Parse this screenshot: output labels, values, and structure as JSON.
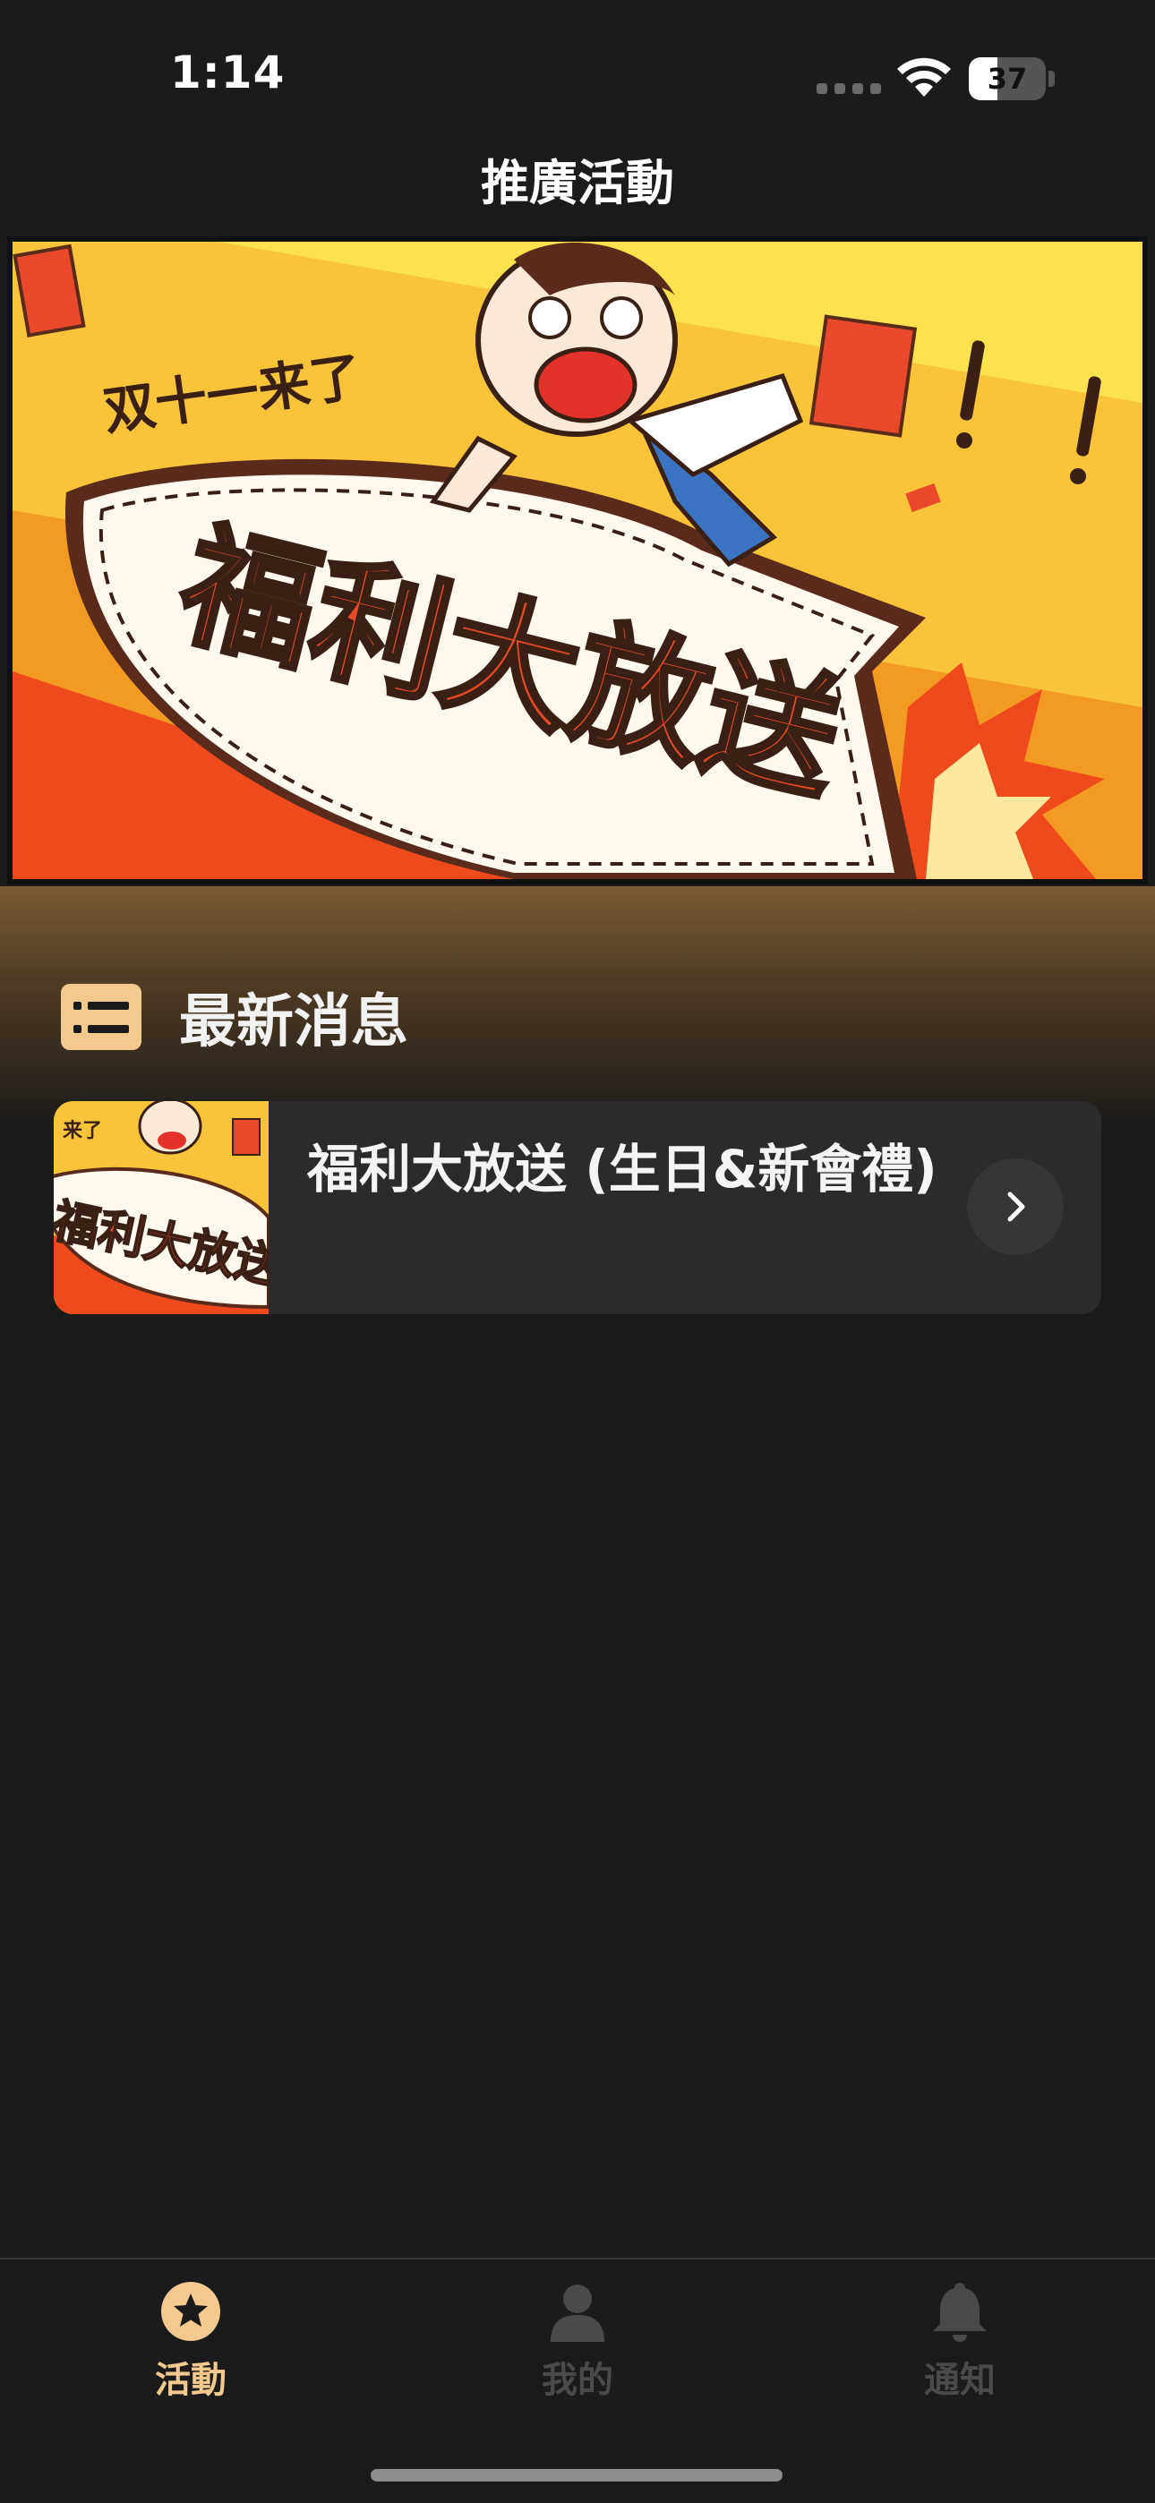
{
  "status_bar": {
    "time": "1:14",
    "battery_level": "37",
    "battery_fraction": 0.37
  },
  "nav": {
    "title": "推廣活動"
  },
  "banner": {
    "caption_small": "双十一来了",
    "caption_main": "福利大放送",
    "exclaim": "!!"
  },
  "section": {
    "icon": "news-list-icon",
    "title": "最新消息"
  },
  "news": [
    {
      "title": "福利大放送 (生日&新會禮)",
      "thumb_text": "福利大放送",
      "thumb_caption": "来了",
      "action_icon": "chevron-right-icon"
    }
  ],
  "tabs": [
    {
      "label": "活動",
      "icon": "star-circle-icon",
      "active": true,
      "color": "#f4c98e"
    },
    {
      "label": "我的",
      "icon": "person-icon",
      "active": false,
      "color": "#4a4a4a"
    },
    {
      "label": "通知",
      "icon": "bell-icon",
      "active": false,
      "color": "#4a4a4a"
    }
  ],
  "colors": {
    "accent": "#f4c98e",
    "background": "#1b1b1b",
    "card": "#2b2b2b",
    "inactive": "#4a4a4a"
  }
}
